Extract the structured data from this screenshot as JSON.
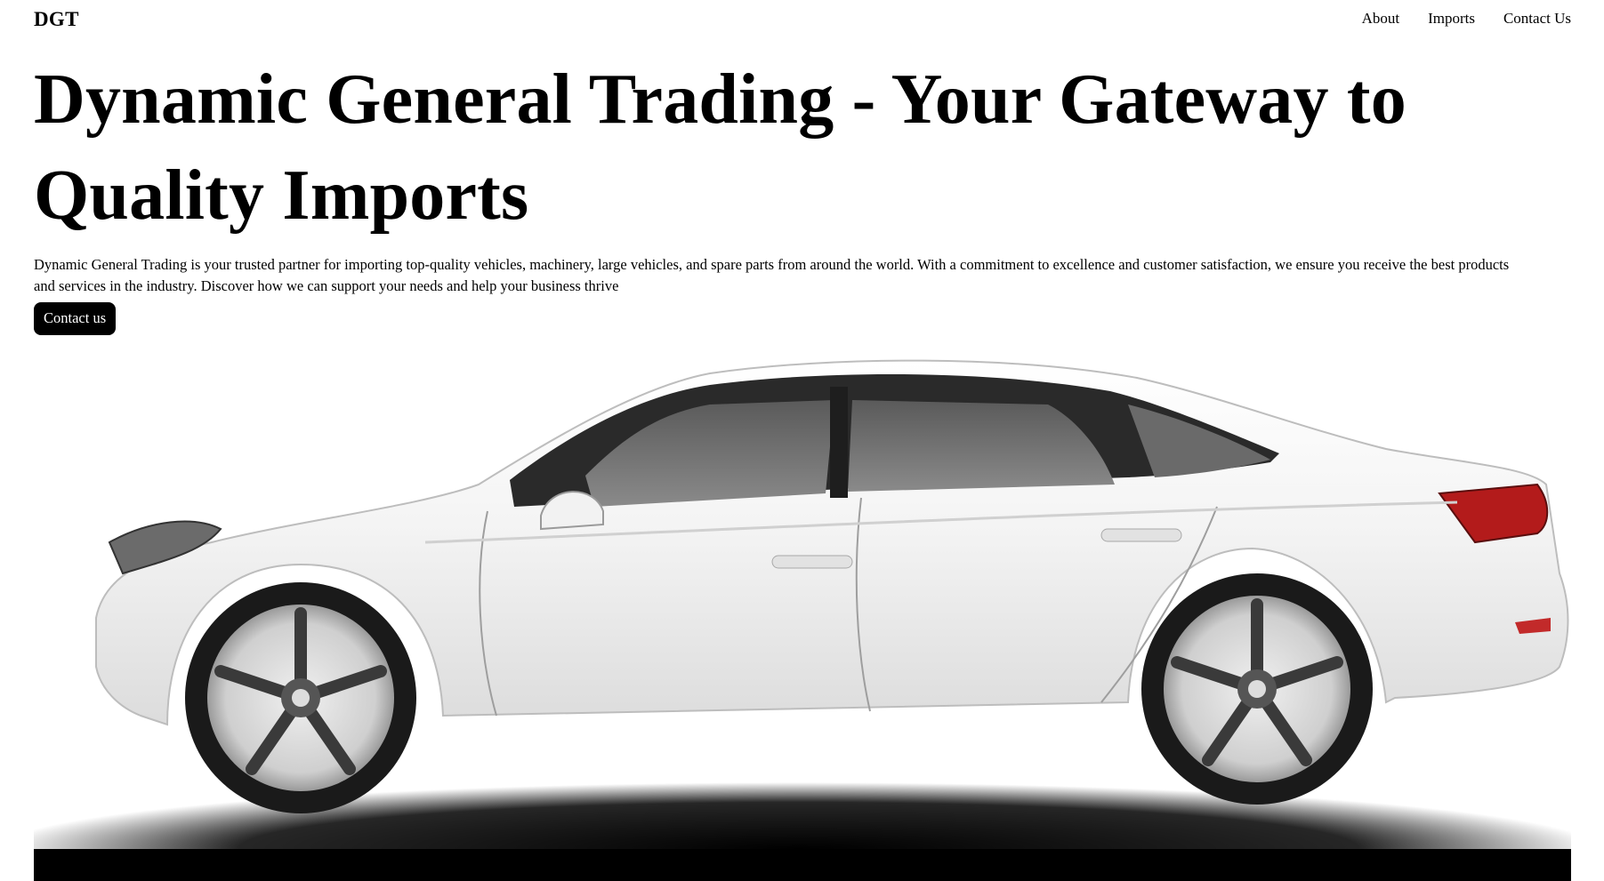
{
  "brand": {
    "logo": "DGT"
  },
  "nav": {
    "items": [
      {
        "label": "About"
      },
      {
        "label": "Imports"
      },
      {
        "label": "Contact Us"
      }
    ]
  },
  "hero": {
    "title": "Dynamic General Trading - Your Gateway to Quality Imports",
    "description": "Dynamic General Trading is your trusted partner for importing top-quality vehicles, machinery, large vehicles, and spare parts from around the world. With a commitment to excellence and customer satisfaction, we ensure you receive the best products and services in the industry. Discover how we can support your needs and help your business thrive",
    "cta_label": "Contact us",
    "image": {
      "subject": "white-sedan-side-view"
    }
  }
}
